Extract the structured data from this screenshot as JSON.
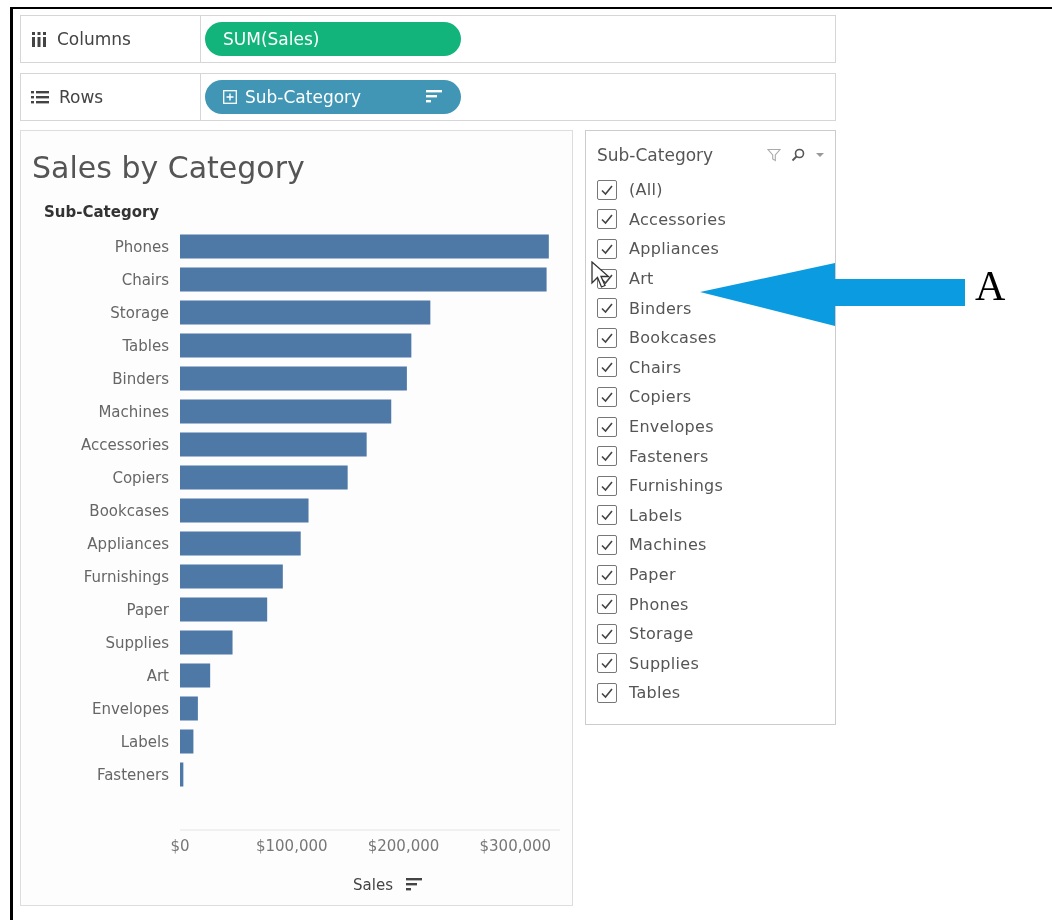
{
  "shelves": [
    {
      "kind": "columns",
      "label": "Columns",
      "pill": {
        "kind": "measure",
        "text": "SUM(Sales)"
      }
    },
    {
      "kind": "rows",
      "label": "Rows",
      "pill": {
        "kind": "dimension",
        "text": "Sub-Category"
      }
    }
  ],
  "chart": {
    "title": "Sales by Category",
    "axis_header": "Sub-Category",
    "chart_data": {
      "type": "bar",
      "orientation": "horizontal",
      "xlabel": "Sales",
      "categories": [
        "Phones",
        "Chairs",
        "Storage",
        "Tables",
        "Binders",
        "Machines",
        "Accessories",
        "Copiers",
        "Bookcases",
        "Appliances",
        "Furnishings",
        "Paper",
        "Supplies",
        "Art",
        "Envelopes",
        "Labels",
        "Fasteners"
      ],
      "series": [
        {
          "color": "#4e79a7",
          "values": [
            330000,
            328000,
            224000,
            207000,
            203000,
            189000,
            167000,
            150000,
            115000,
            108000,
            92000,
            78000,
            47000,
            27000,
            16000,
            12000,
            3000
          ]
        }
      ],
      "xlim": [
        0,
        340000
      ],
      "xticks": [
        {
          "value": 0,
          "label": "$0"
        },
        {
          "value": 100000,
          "label": "$100,000"
        },
        {
          "value": 200000,
          "label": "$200,000"
        },
        {
          "value": 300000,
          "label": "$300,000"
        }
      ]
    }
  },
  "filter": {
    "title": "Sub-Category",
    "items": [
      {
        "label": "(All)",
        "checked": true
      },
      {
        "label": "Accessories",
        "checked": true
      },
      {
        "label": "Appliances",
        "checked": true
      },
      {
        "label": "Art",
        "checked": true
      },
      {
        "label": "Binders",
        "checked": true
      },
      {
        "label": "Bookcases",
        "checked": true
      },
      {
        "label": "Chairs",
        "checked": true
      },
      {
        "label": "Copiers",
        "checked": true
      },
      {
        "label": "Envelopes",
        "checked": true
      },
      {
        "label": "Fasteners",
        "checked": true
      },
      {
        "label": "Furnishings",
        "checked": true
      },
      {
        "label": "Labels",
        "checked": true
      },
      {
        "label": "Machines",
        "checked": true
      },
      {
        "label": "Paper",
        "checked": true
      },
      {
        "label": "Phones",
        "checked": true
      },
      {
        "label": "Storage",
        "checked": true
      },
      {
        "label": "Supplies",
        "checked": true
      },
      {
        "label": "Tables",
        "checked": true
      }
    ]
  },
  "callout": {
    "label": "A"
  }
}
